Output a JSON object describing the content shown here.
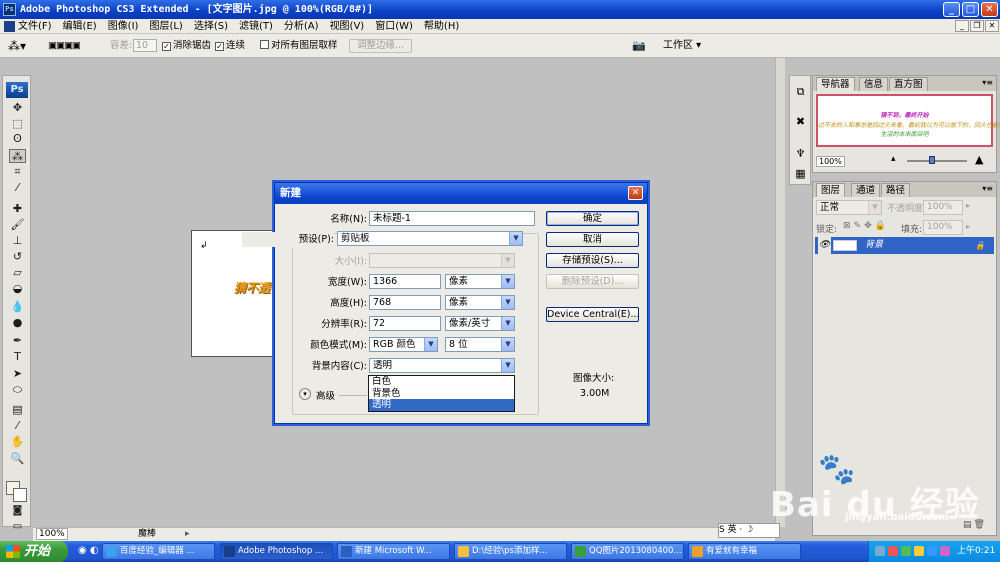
{
  "window": {
    "title": "Adobe Photoshop CS3 Extended - [文字图片.jpg @ 100%(RGB/8#)]",
    "min": "_",
    "max": "□",
    "close": "✕",
    "ps_mini": "Ps"
  },
  "menu": {
    "items": [
      "文件(F)",
      "编辑(E)",
      "图像(I)",
      "图层(L)",
      "选择(S)",
      "滤镜(T)",
      "分析(A)",
      "视图(V)",
      "窗口(W)",
      "帮助(H)"
    ]
  },
  "options": {
    "tolerance_label": "容差:",
    "tolerance_value": "10",
    "antialias_label": "消除锯齿",
    "contiguous_label": "连续",
    "all_layers_label": "对所有图层取样",
    "refine_edge_label": "调整边缘...",
    "workspace_label": "工作区 ▾"
  },
  "toolbox": {
    "logo": "Ps",
    "tools": [
      {
        "name": "move-tool-icon",
        "glyph": "✥"
      },
      {
        "name": "marquee-tool-icon",
        "glyph": "⬚"
      },
      {
        "name": "lasso-tool-icon",
        "glyph": "ʘ"
      },
      {
        "name": "magic-wand-tool-icon",
        "glyph": "⁂"
      },
      {
        "name": "crop-tool-icon",
        "glyph": "⌗"
      },
      {
        "name": "eyedropper-tool-icon",
        "glyph": "⁄"
      },
      {
        "name": "healing-brush-tool-icon",
        "glyph": "✚"
      },
      {
        "name": "brush-tool-icon",
        "glyph": "🖌"
      },
      {
        "name": "clone-stamp-tool-icon",
        "glyph": "⊥"
      },
      {
        "name": "history-brush-tool-icon",
        "glyph": "↺"
      },
      {
        "name": "eraser-tool-icon",
        "glyph": "▱"
      },
      {
        "name": "paint-bucket-tool-icon",
        "glyph": "◒"
      },
      {
        "name": "blur-tool-icon",
        "glyph": "💧"
      },
      {
        "name": "dodge-tool-icon",
        "glyph": "●"
      },
      {
        "name": "pen-tool-icon",
        "glyph": "✒"
      },
      {
        "name": "type-tool-icon",
        "glyph": "T"
      },
      {
        "name": "path-selection-tool-icon",
        "glyph": "➤"
      },
      {
        "name": "shape-tool-icon",
        "glyph": "⬭"
      },
      {
        "name": "notes-tool-icon",
        "glyph": "▤"
      },
      {
        "name": "eyedropper2-tool-icon",
        "glyph": "⁄"
      },
      {
        "name": "hand-tool-icon",
        "glyph": "✋"
      },
      {
        "name": "zoom-tool-icon",
        "glyph": "🔍"
      }
    ]
  },
  "canvas": {
    "partial_text": "猜不透"
  },
  "status": {
    "zoom": "100%",
    "info": "魔棒"
  },
  "navigator": {
    "tabs": [
      "导航器",
      "信息",
      "直方图"
    ],
    "preview_lines": [
      "猜不到，最终开始",
      "过不去的人和事总是回过头来看，最初我以为可以放下的，回头也能淡然",
      "生活的本来面目吧"
    ],
    "zoom": "100%"
  },
  "layers": {
    "tabs": [
      "图层",
      "通道",
      "路径"
    ],
    "blend_mode": "正常",
    "opacity_label": "不透明度:",
    "opacity": "100%",
    "lock_label": "锁定:",
    "fill_label": "填充:",
    "fill": "100%",
    "rows": [
      {
        "name": "背景"
      }
    ]
  },
  "dialog": {
    "title": "新建",
    "name_label": "名称(N):",
    "name_value": "未标题-1",
    "preset_label": "预设(P):",
    "preset_value": "剪贴板",
    "size_label": "大小(I):",
    "width_label": "宽度(W):",
    "width_value": "1366",
    "width_unit": "像素",
    "height_label": "高度(H):",
    "height_value": "768",
    "height_unit": "像素",
    "resolution_label": "分辨率(R):",
    "resolution_value": "72",
    "resolution_unit": "像素/英寸",
    "color_mode_label": "颜色模式(M):",
    "color_mode_value": "RGB 颜色",
    "bit_depth": "8 位",
    "bg_label": "背景内容(C):",
    "bg_value": "透明",
    "bg_options": [
      "白色",
      "背景色",
      "透明"
    ],
    "bg_selected": 2,
    "advanced_label": "高级",
    "ok": "确定",
    "cancel": "取消",
    "save_preset": "存储预设(S)...",
    "delete_preset": "删除预设(D)...",
    "device_central": "Device Central(E)...",
    "image_size_label": "图像大小:",
    "image_size_value": "3.00M"
  },
  "watermark": {
    "brand": "Bai du 经验",
    "url": "jingyan.baidu.com"
  },
  "ime": {
    "text": "S 英 · ☽"
  },
  "taskbar": {
    "start": "开始",
    "tasks": [
      {
        "label": "百度经验_编辑器 ..."
      },
      {
        "label": "Adobe Photoshop ..."
      },
      {
        "label": "新建 Microsoft W..."
      },
      {
        "label": "D:\\经验\\ps添加样..."
      },
      {
        "label": "QQ图片2013080400..."
      },
      {
        "label": "有爱就有幸福"
      }
    ],
    "clock": "上午0:21"
  }
}
